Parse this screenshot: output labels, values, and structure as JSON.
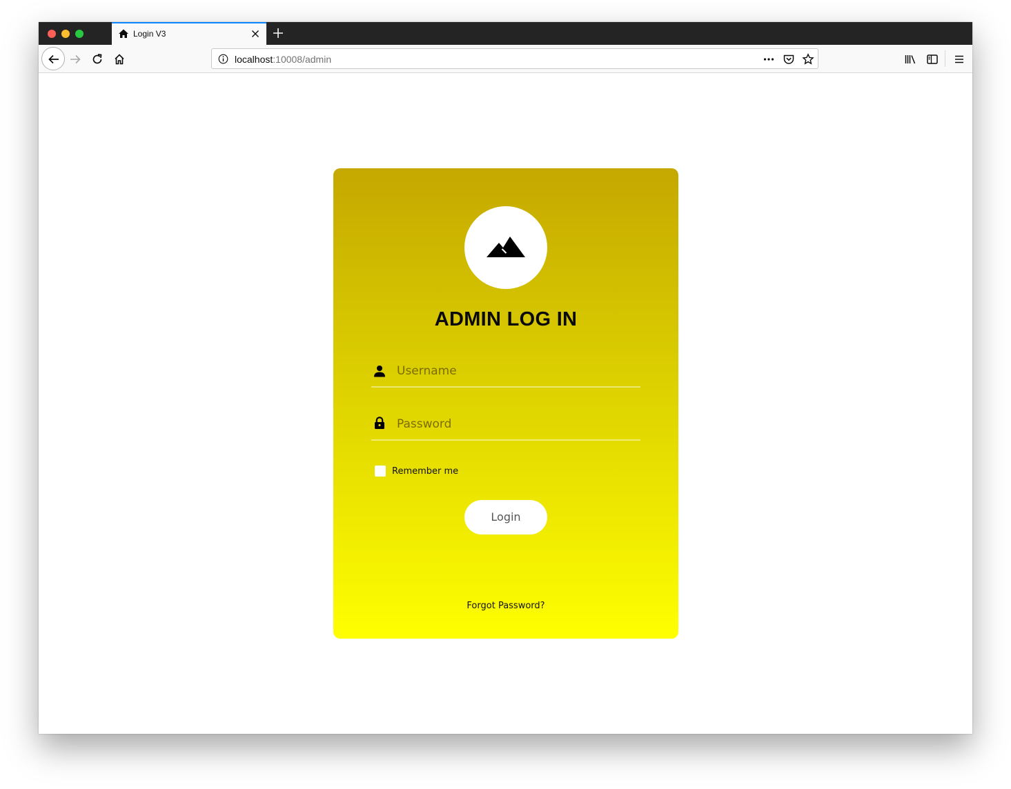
{
  "browser": {
    "tab": {
      "title": "Login V3",
      "favicon": "home-icon"
    },
    "url": {
      "host": "localhost",
      "rest": ":10008/admin"
    },
    "toolbar_icons": [
      "back-arrow-icon",
      "forward-arrow-icon",
      "reload-icon",
      "home-icon",
      "page-actions-icon",
      "pocket-icon",
      "bookmark-star-icon",
      "library-icon",
      "sidebar-icon",
      "hamburger-menu-icon"
    ]
  },
  "login": {
    "logo": "mountain-icon",
    "title": "ADMIN LOG IN",
    "username": {
      "placeholder": "Username",
      "value": ""
    },
    "password": {
      "placeholder": "Password",
      "value": ""
    },
    "remember_label": "Remember me",
    "remember_checked": false,
    "button_label": "Login",
    "forgot_label": "Forgot Password?"
  },
  "colors": {
    "card_gradient_top": "#c5a800",
    "card_gradient_bottom": "#ffff00",
    "tab_accent": "#0a84ff"
  }
}
